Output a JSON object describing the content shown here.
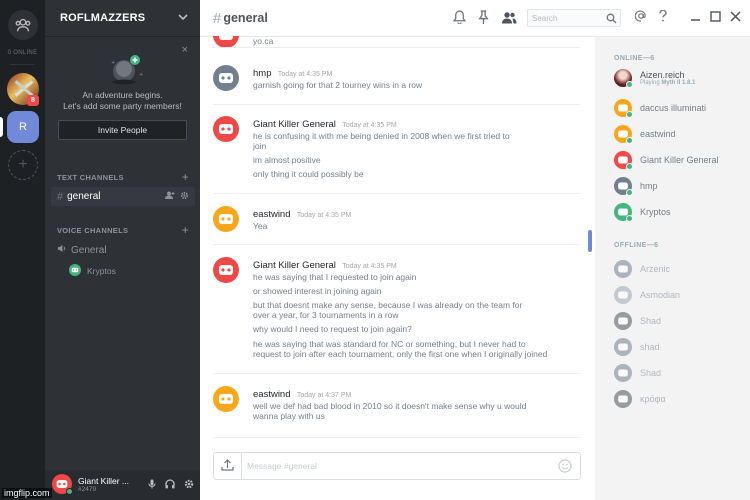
{
  "colors": {
    "blurple": "#7289da",
    "red": "#f04747",
    "online": "#43b581",
    "orange": "#faa61a",
    "grey": "#747f8d",
    "green": "#43b581"
  },
  "guilds": {
    "online_count": "0 ONLINE",
    "badge": "8",
    "selected_letter": "R",
    "add": "+"
  },
  "server": {
    "name": "ROFLMAZZERS",
    "chevron": "⌄"
  },
  "invite": {
    "close": "×",
    "text_line1": "An adventure begins.",
    "text_line2": "Let's add some party members!",
    "button": "Invite People"
  },
  "channels": {
    "text_category": "TEXT CHANNELS",
    "voice_category": "VOICE CHANNELS",
    "add": "+",
    "active_channel": "general",
    "voice_channel": "General",
    "voice_user": "Kryptos"
  },
  "user_panel": {
    "name": "Giant Killer ...",
    "discriminator": "#2479"
  },
  "topbar": {
    "channel": "general",
    "search_placeholder": "Search"
  },
  "messages": [
    {
      "author": "",
      "time": "",
      "color": "#f04747",
      "lines": [
        "yo.ca"
      ]
    },
    {
      "author": "hmp",
      "time": "Today at 4:35 PM",
      "color": "#747f8d",
      "lines": [
        "garnish going for that 2 tourney wins in a row"
      ]
    },
    {
      "author": "Giant Killer General",
      "time": "Today at 4:35 PM",
      "color": "#f04747",
      "lines": [
        "he is confusing it with me being denied in 2008 when we first tried to",
        "join",
        "im almost positive",
        "only thing it could possibly be"
      ]
    },
    {
      "author": "eastwind",
      "time": "Today at 4:35 PM",
      "color": "#faa61a",
      "lines": [
        "Yea"
      ]
    },
    {
      "author": "Giant Killer General",
      "time": "Today at 4:35 PM",
      "color": "#f04747",
      "lines": [
        "he was saying that I requested to join again",
        "or showed interest in joining again",
        "but that doesnt make any sense, because I was already on the team for",
        "over a year, for 3 tournaments in a row",
        "why would I need to request to join again?",
        "he was saying that was standard for NC or something, but I never had to",
        "request to join after each tournament, only the first one when I originally joined"
      ]
    },
    {
      "author": "eastwind",
      "time": "Today at 4:37 PM",
      "color": "#faa61a",
      "lines": [
        "well we def had bad blood in 2010 so it doesn't make sense why u would",
        "wanna play with us"
      ]
    }
  ],
  "composer": {
    "placeholder": "Message #general"
  },
  "members": {
    "online_label": "ONLINE—6",
    "offline_label": "OFFLINE—6",
    "online": [
      {
        "name": "Aizen.reich",
        "sub_prefix": "Playing ",
        "sub_game": "Myth II 1.8.1",
        "color": "#c9a0a0",
        "avatar": "photo"
      },
      {
        "name": "daccus illuminati",
        "color": "#faa61a"
      },
      {
        "name": "eastwind",
        "color": "#faa61a"
      },
      {
        "name": "Giant Killer General",
        "color": "#f04747"
      },
      {
        "name": "hmp",
        "color": "#747f8d"
      },
      {
        "name": "Kryptos",
        "color": "#43b581"
      }
    ],
    "offline": [
      {
        "name": "Arzenic",
        "color": "#747f8d"
      },
      {
        "name": "Asmodian",
        "color": "#99aab5"
      },
      {
        "name": "Shad",
        "color": "#4f545c"
      },
      {
        "name": "shad",
        "color": "#747f8d"
      },
      {
        "name": "Shad",
        "color": "#747f8d"
      },
      {
        "name": "κρόφα",
        "color": "#4f545c"
      }
    ]
  },
  "watermark": "imgflip.com"
}
